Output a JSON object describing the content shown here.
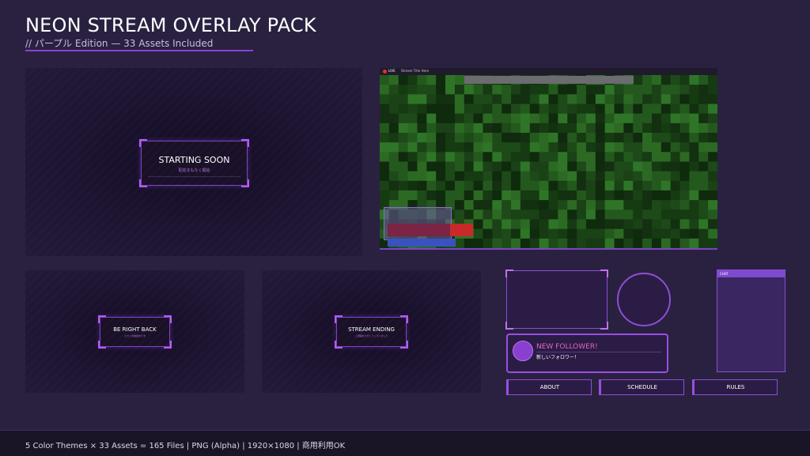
{
  "header": {
    "title": "NEON STREAM OVERLAY PACK",
    "subtitle": "// パープル Edition — 33 Assets Included"
  },
  "scenes": {
    "starting": {
      "title": "STARTING SOON",
      "sub": "配信まもなく開始"
    },
    "brb": {
      "title": "BE RIGHT BACK",
      "sub": "ただいま離席中です"
    },
    "ending": {
      "title": "STREAM ENDING",
      "sub": "ご視聴ありがとうございました"
    }
  },
  "game_screen": {
    "live_label": "LIVE",
    "stream_title": "Stream Title Here"
  },
  "chat": {
    "header": "CHAT"
  },
  "alert": {
    "title": "NEW FOLLOWER!",
    "sub": "新しいフォロワー！"
  },
  "panels": [
    "ABOUT",
    "SCHEDULE",
    "RULES"
  ],
  "footer": {
    "text": "5 Color Themes × 33 Assets = 165 Files  |  PNG (Alpha)  |  1920×1080  |  商用利用OK"
  },
  "colors": {
    "accent": "#8b3fd9",
    "alert_title": "#e066c0",
    "background": "#2a2140"
  }
}
